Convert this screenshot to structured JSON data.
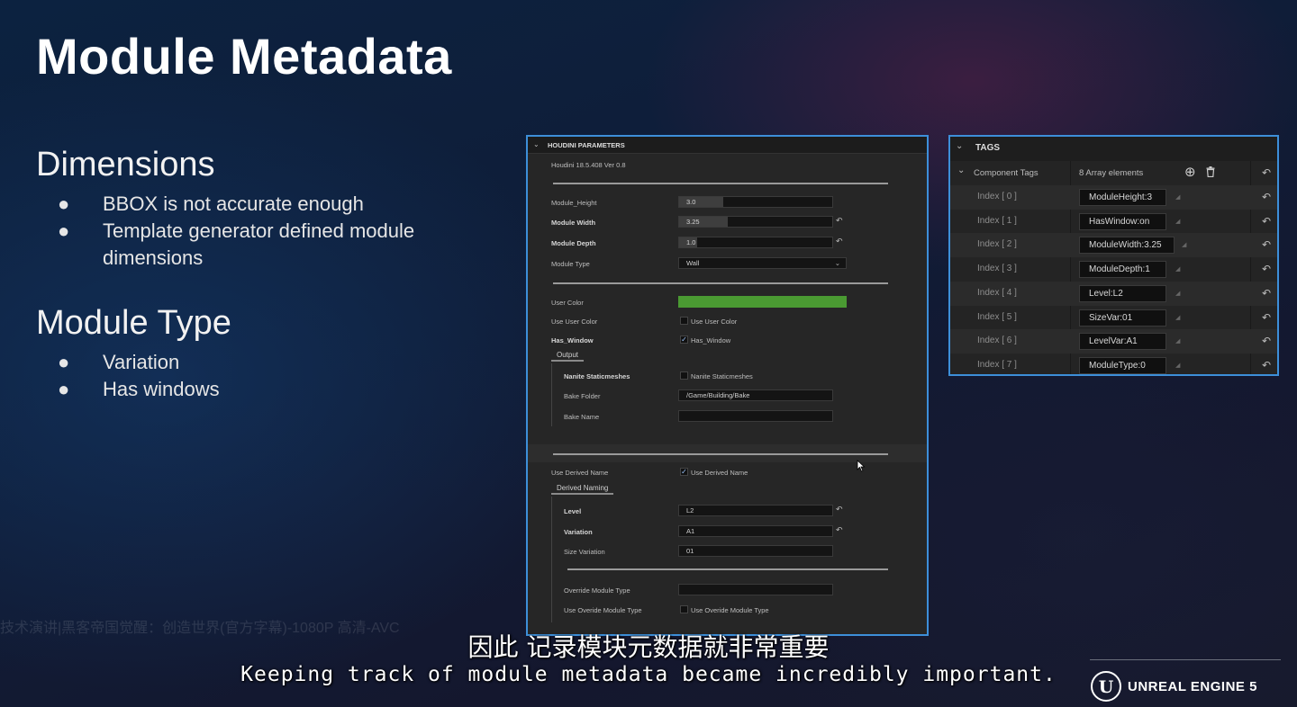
{
  "slide": {
    "title": "Module Metadata",
    "dimensions_heading": "Dimensions",
    "dimensions_bullets": [
      "BBOX is not accurate enough",
      "Template generator defined module",
      "dimensions"
    ],
    "type_heading": "Module Type",
    "type_bullets": [
      "Variation",
      "Has windows"
    ],
    "bullet_glyph": "●"
  },
  "houdini": {
    "header": "HOUDINI PARAMETERS",
    "version": "Houdini 18.5.408 Ver 0.8",
    "params": {
      "module_height": {
        "label": "Module_Height",
        "value": "3.0",
        "fill": 0.29
      },
      "module_width": {
        "label": "Module Width",
        "value": "3.25",
        "fill": 0.32
      },
      "module_depth": {
        "label": "Module Depth",
        "value": "1.0",
        "fill": 0.12
      },
      "module_type": {
        "label": "Module Type",
        "value": "Wall"
      },
      "user_color": {
        "label": "User Color",
        "color": "#4a9a32"
      },
      "use_user_color": {
        "label": "Use User Color",
        "check_label": "Use User Color",
        "checked": false
      },
      "has_window": {
        "label": "Has_Window",
        "check_label": "Has_Window",
        "checked": true
      }
    },
    "output": {
      "group": "Output",
      "nanite": {
        "label": "Nanite Staticmeshes",
        "check_label": "Nanite Staticmeshes",
        "checked": false
      },
      "bake_folder": {
        "label": "Bake Folder",
        "value": "/Game/Building/Bake"
      },
      "bake_name": {
        "label": "Bake Name",
        "value": ""
      }
    },
    "derived": {
      "use_derived": {
        "label": "Use Derived Name",
        "check_label": "Use Derived Name",
        "checked": true
      },
      "group": "Derived Naming",
      "level": {
        "label": "Level",
        "value": "L2"
      },
      "variation": {
        "label": "Variation",
        "value": "A1"
      },
      "size_variation": {
        "label": "Size Variation",
        "value": "01"
      },
      "override_type": {
        "label": "Override Module Type",
        "value": ""
      },
      "use_override": {
        "label": "Use Overide Module Type",
        "check_label": "Use Overide Module Type",
        "checked": false
      }
    },
    "reset_glyph": "↶",
    "chevron_glyph": "⌄",
    "check_glyph": "✓"
  },
  "tags": {
    "header": "TAGS",
    "component_tags": "Component Tags",
    "array_count": "8 Array elements",
    "add_glyph": "⊕",
    "delete_glyph": "🗑",
    "reset_glyph": "↶",
    "rows": [
      {
        "index": "Index [ 0 ]",
        "value": "ModuleHeight:3"
      },
      {
        "index": "Index [ 1 ]",
        "value": "HasWindow:on"
      },
      {
        "index": "Index [ 2 ]",
        "value": "ModuleWidth:3.25"
      },
      {
        "index": "Index [ 3 ]",
        "value": "ModuleDepth:1"
      },
      {
        "index": "Index [ 4 ]",
        "value": "Level:L2"
      },
      {
        "index": "Index [ 5 ]",
        "value": "SizeVar:01"
      },
      {
        "index": "Index [ 6 ]",
        "value": "LevelVar:A1"
      },
      {
        "index": "Index [ 7 ]",
        "value": "ModuleType:0"
      }
    ]
  },
  "subtitles": {
    "chinese": "因此 记录模块元数据就非常重要",
    "english": "Keeping track of module metadata became incredibly important."
  },
  "watermark": "技术演讲|黑客帝国觉醒：创造世界(官方字幕)-1080P 高清-AVC",
  "brand": {
    "name": "UNREAL ENGINE 5",
    "logo_letter": "U"
  }
}
